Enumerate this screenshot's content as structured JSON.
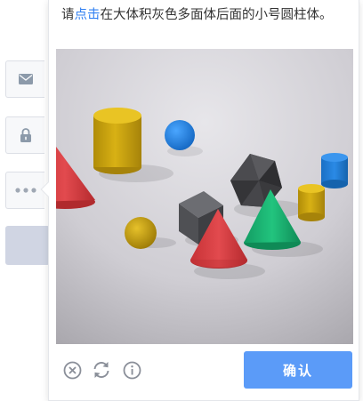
{
  "captcha": {
    "instruction_pre": "请",
    "instruction_link": "点击",
    "instruction_post": "在大体积灰色多面体后面的小号圆柱体。",
    "confirm_label": "确认"
  },
  "toolbar": {
    "close_icon": "circle-x-icon",
    "refresh_icon": "refresh-icon",
    "info_icon": "info-icon"
  },
  "colors": {
    "accent": "#2f7ff2",
    "confirm_bg": "#5b9bf8",
    "bg_button": "#d0d5e3",
    "icon_gray": "#8a8f99"
  },
  "background_form": {
    "icons": [
      "mail-icon",
      "lock-icon",
      "more-dots-icon"
    ]
  }
}
